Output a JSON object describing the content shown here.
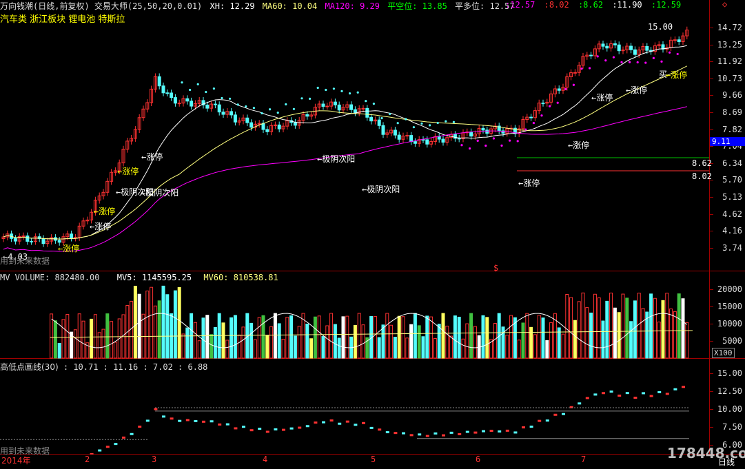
{
  "header": {
    "title": "万向钱潮(日线,前复权) 交易大师(25,50,20,0.01)",
    "xh": "XH: 12.29",
    "ma60": "MA60: 10.04",
    "ma120": "MA120: 9.29",
    "pkw": "平空位: 13.85",
    "pdw": "平多位: 12.57",
    "right_values": [
      ":12.57",
      ":8.02",
      ":8.62",
      ":11.90",
      ":12.59"
    ],
    "sectors": "汽车类 浙江板块 锂电池 特斯拉",
    "top_right_symbol": "◇"
  },
  "main_panel": {
    "price_axis": [
      "14.72",
      "13.25",
      "11.92",
      "10.73",
      "9.66",
      "8.69",
      "7.82",
      "7.04",
      "6.34",
      "5.70",
      "5.13",
      "4.62",
      "4.16",
      "3.74"
    ],
    "current_price_badge": "9.11",
    "level_lines": [
      "8.62",
      "8.02"
    ],
    "high_label": "15.00",
    "low_label": "←4.03",
    "future_text": "用到未来数据",
    "dollar_mark": "$",
    "annotations": [
      "←涨停",
      "←涨停",
      "←极阴次阳",
      "←涨停",
      "←涨停",
      "←涨停",
      "←极阴次阳",
      "←极阴次阳",
      "←涨停",
      "←涨停",
      "←涨停",
      "←涨停",
      "买",
      "←涨停"
    ]
  },
  "volume_panel": {
    "title": "MV VOLUME: 882480.00",
    "mv5": "MV5: 1145595.25",
    "mv60": "MV60: 810538.81",
    "axis": [
      "20000",
      "15000",
      "10000",
      "5000"
    ],
    "unit": "X100"
  },
  "indicator_panel": {
    "title": "高低点画线(30)",
    "values": ": 10.71 : 11.16 : 7.02 : 6.88",
    "axis": [
      "15.00",
      "12.50",
      "10.00",
      "7.50",
      "6.00"
    ],
    "future_text": "用到未来数据"
  },
  "time_axis": {
    "labels": [
      "2014年",
      "2",
      "3",
      "4",
      "5",
      "6",
      "7"
    ],
    "period": "日线"
  },
  "watermark": "178448.com",
  "colors": {
    "up": "#ff3232",
    "down": "#54fcfc",
    "separator": "#a00000",
    "ma_white": "#ffffff",
    "ma_yellow": "#ffff80",
    "ma_magenta": "#ff00ff",
    "dots_cyan": "#54fcfc",
    "dots_magenta": "#ff00ff",
    "level_green": "#00c000",
    "badge_blue": "#0000ff",
    "ann_yellow": "#ffff00"
  }
}
